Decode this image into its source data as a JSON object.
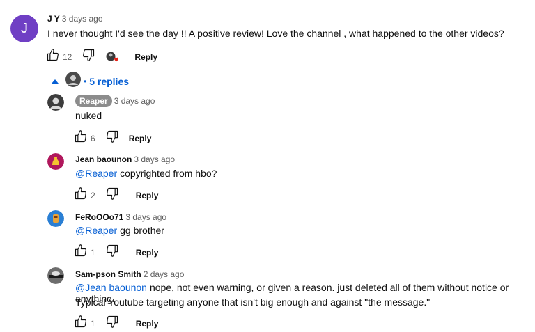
{
  "top_comment": {
    "avatar_letter": "J",
    "author": "J Y",
    "time": "3 days ago",
    "text": "I never thought I'd see the day !! A positive review!  Love the channel , what happened to the other videos?",
    "likes": "12",
    "reply_label": "Reply"
  },
  "replies_toggle": {
    "label": "5 replies",
    "separator": "•"
  },
  "replies": [
    {
      "author": "Reaper",
      "time": "3 days ago",
      "mention": "",
      "text": "nuked",
      "likes": "6",
      "reply_label": "Reply"
    },
    {
      "author": "Jean baounon",
      "time": "3 days ago",
      "mention": "@Reaper",
      "text": "copyrighted from hbo?",
      "likes": "2",
      "reply_label": "Reply"
    },
    {
      "author": "FeRoOOo71",
      "time": "3 days ago",
      "mention": "@Reaper",
      "text": "gg brother",
      "likes": "1",
      "reply_label": "Reply"
    },
    {
      "author": "Sam-pson Smith",
      "time": "2 days ago",
      "mention": "@Jean baounon",
      "text": "nope, not even warning, or given a reason. just deleted all of them without notice or anything.",
      "text2": "Typical Youtube targeting anyone that isn't big enough and against \"the message.\"",
      "likes": "1",
      "reply_label": "Reply"
    }
  ],
  "colors": {
    "link": "#065fd4",
    "avatar_main": "#6f3fc4",
    "heart": "#e62117"
  }
}
